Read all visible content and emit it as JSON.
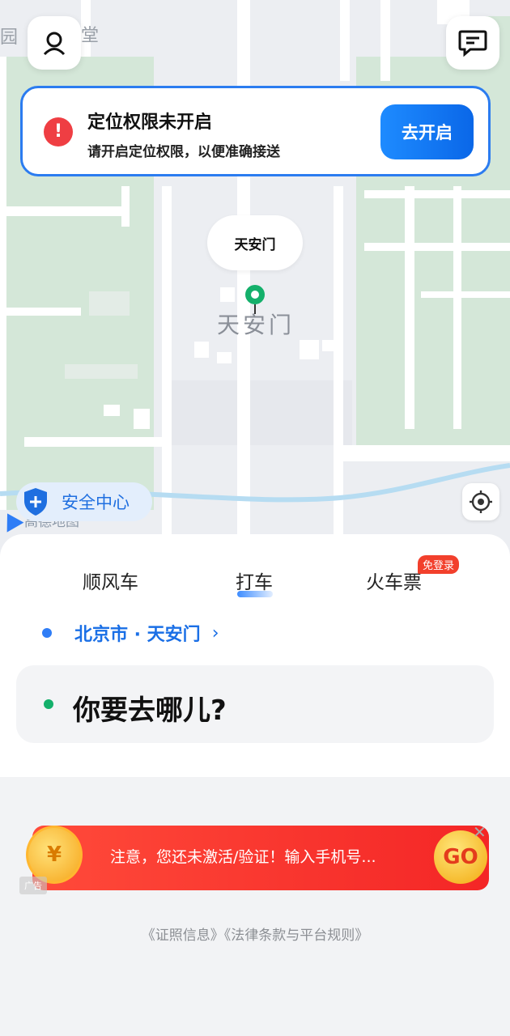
{
  "map": {
    "landmark_label": "天安门",
    "corner_left": "园",
    "corner_right": "堂",
    "logo_text": "高德地图"
  },
  "permission": {
    "title": "定位权限未开启",
    "subtitle": "请开启定位权限，以便准确接送",
    "button": "去开启"
  },
  "pin": {
    "label": "天安门"
  },
  "safety": {
    "label": "安全中心"
  },
  "tabs": [
    {
      "label": "顺风车"
    },
    {
      "label": "打车"
    },
    {
      "label": "火车票"
    }
  ],
  "train_badge": "免登录",
  "origin": {
    "label": "北京市 · 天安门",
    "chevron": "›"
  },
  "destination": {
    "placeholder": "你要去哪儿?"
  },
  "ad": {
    "text": "注意，您还未激活/验证！输入手机号...",
    "coin_symbol": "¥",
    "go_text": "GO",
    "close": "✕",
    "tag": "广告"
  },
  "footer": "《证照信息》《法律条款与平台规则》",
  "colors": {
    "accent": "#2b7cf0",
    "warning": "#ef3e43",
    "origin_dot": "#2f7df6",
    "dest_dot": "#14b06b",
    "ad_red": "#f42626"
  }
}
